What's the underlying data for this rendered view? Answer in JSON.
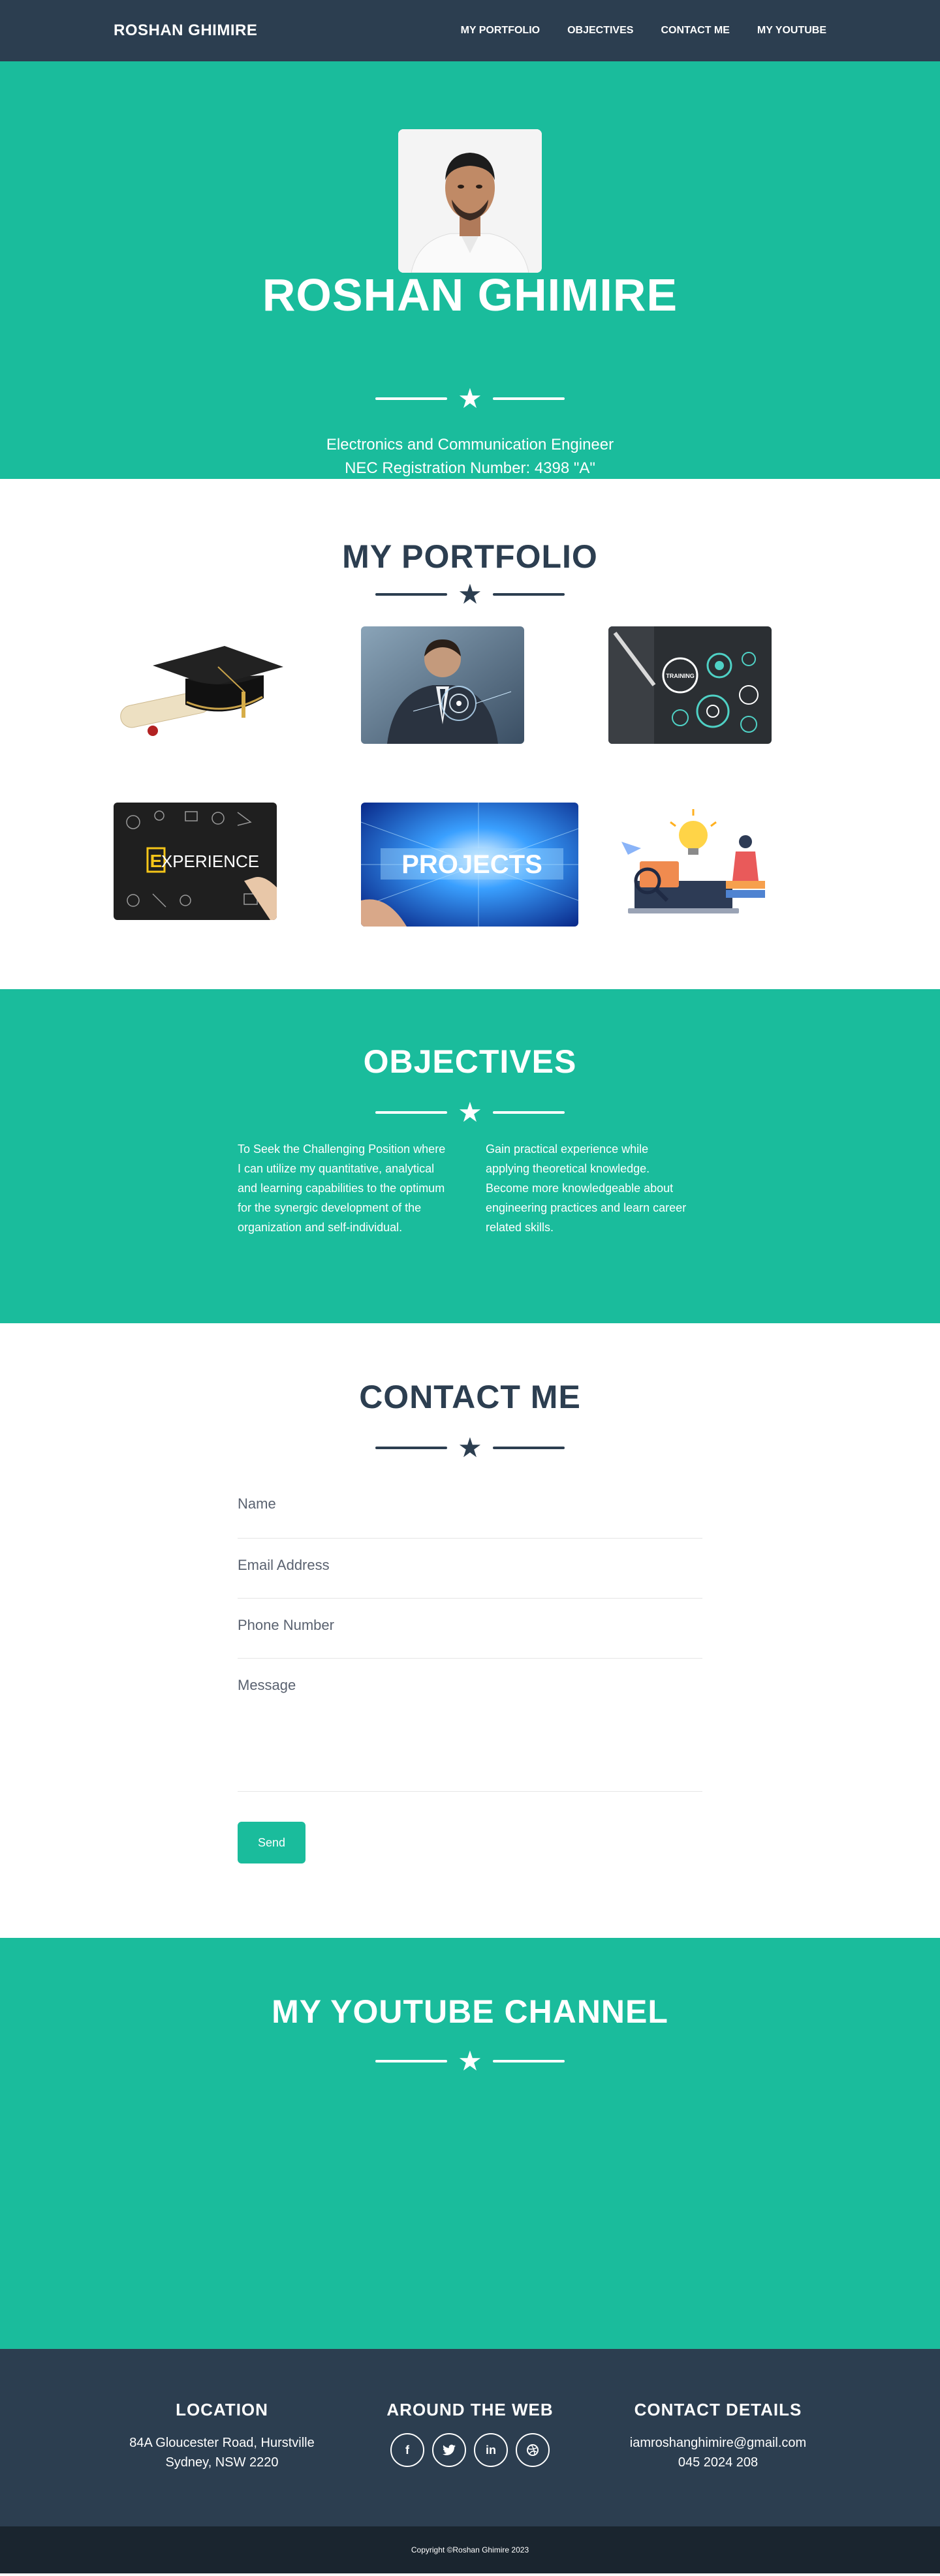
{
  "nav": {
    "brand": "ROSHAN GHIMIRE",
    "links": [
      "MY PORTFOLIO",
      "OBJECTIVES",
      "CONTACT ME",
      "MY YOUTUBE"
    ]
  },
  "hero": {
    "name": "ROSHAN GHIMIRE",
    "subtitle_line1": "Electronics and Communication Engineer",
    "subtitle_line2": "NEC Registration Number: 4398 \"A\""
  },
  "portfolio": {
    "title": "MY PORTFOLIO",
    "items": [
      {
        "image": "graduation-cap-and-diploma"
      },
      {
        "image": "businessman-with-digital-interface"
      },
      {
        "image": "training-gears"
      },
      {
        "image": "experience-chalkboard",
        "text": "EXPERIENCE"
      },
      {
        "image": "projects-blue-world-map",
        "text": "PROJECTS"
      },
      {
        "image": "online-learning-illustration"
      }
    ]
  },
  "objectives": {
    "title": "OBJECTIVES",
    "left": "To Seek the Challenging Position where I can utilize my quantitative, analytical and learning capabilities to the optimum for the synergic development of the organization and self-individual.",
    "right": "Gain practical experience while applying theoretical knowledge. Become more knowledgeable about engineering practices and learn career related skills."
  },
  "contact": {
    "title": "CONTACT ME",
    "name_placeholder": "Name",
    "email_placeholder": "Email Address",
    "phone_placeholder": "Phone Number",
    "message_placeholder": "Message",
    "send_label": "Send"
  },
  "youtube": {
    "title": "MY YOUTUBE CHANNEL"
  },
  "footer": {
    "location_title": "LOCATION",
    "location_line1": "84A Gloucester Road, Hurstville",
    "location_line2": "Sydney, NSW 2220",
    "web_title": "AROUND THE WEB",
    "socials": [
      "facebook-icon",
      "twitter-icon",
      "linkedin-icon",
      "dribbble-icon"
    ],
    "contact_title": "CONTACT DETAILS",
    "email": "iamroshanghimire@gmail.com",
    "phone": "045 2024 208",
    "copyright": "Copyright ©Roshan Ghimire 2023"
  },
  "colors": {
    "primary": "#2c3e50",
    "accent": "#1abc9c",
    "dark": "#1a252f"
  }
}
